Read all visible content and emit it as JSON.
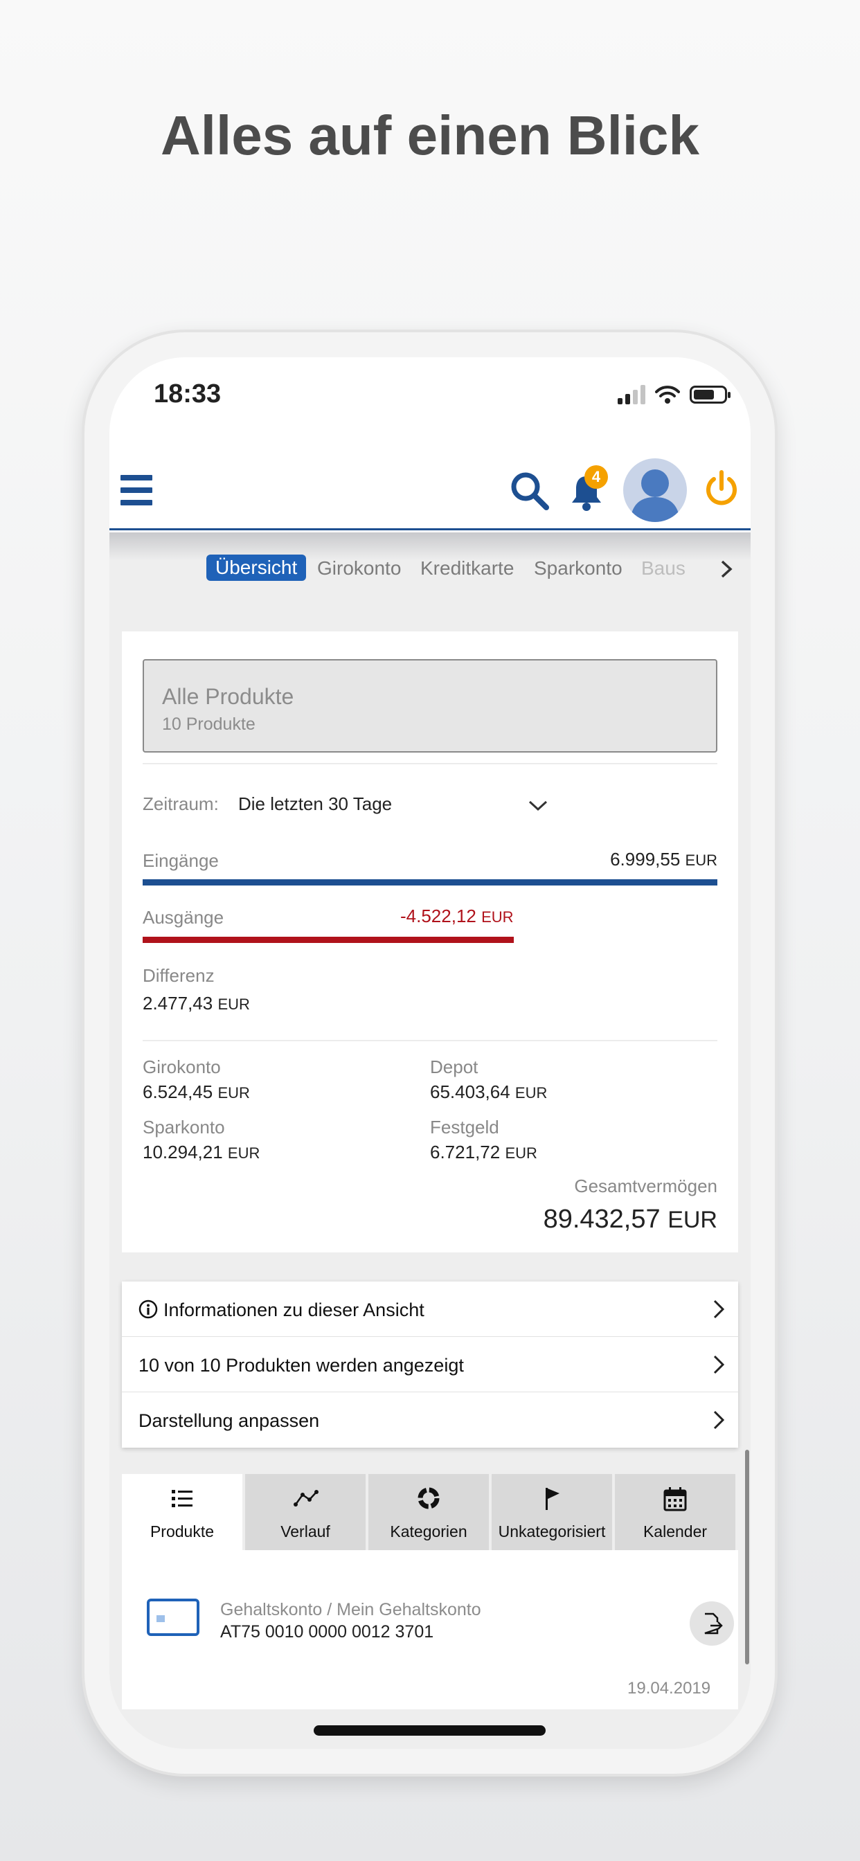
{
  "headline": "Alles auf einen Blick",
  "status": {
    "time": "18:33"
  },
  "header": {
    "notification_count": "4"
  },
  "tabs": [
    {
      "label": "Übersicht",
      "active": true
    },
    {
      "label": "Girokonto"
    },
    {
      "label": "Kreditkarte"
    },
    {
      "label": "Sparkonto"
    },
    {
      "label": "Baus"
    }
  ],
  "products": {
    "title": "Alle Produkte",
    "count": "10 Produkte"
  },
  "period": {
    "label": "Zeitraum:",
    "value": "Die letzten 30 Tage"
  },
  "income": {
    "label": "Eingänge",
    "amount": "6.999,55",
    "currency": "EUR",
    "bar_fraction": 1.0
  },
  "expenses": {
    "label": "Ausgänge",
    "amount": "-4.522,12",
    "currency": "EUR",
    "bar_fraction": 0.646
  },
  "difference": {
    "label": "Differenz",
    "amount": "2.477,43",
    "currency": "EUR"
  },
  "accounts": [
    {
      "label": "Girokonto",
      "amount": "6.524,45",
      "currency": "EUR"
    },
    {
      "label": "Depot",
      "amount": "65.403,64",
      "currency": "EUR"
    },
    {
      "label": "Sparkonto",
      "amount": "10.294,21",
      "currency": "EUR"
    },
    {
      "label": "Festgeld",
      "amount": "6.721,72",
      "currency": "EUR"
    }
  ],
  "total": {
    "label": "Gesamtvermögen",
    "amount": "89.432,57",
    "currency": "EUR"
  },
  "menu": [
    {
      "label": "Informationen zu dieser Ansicht"
    },
    {
      "label": "10 von 10 Produkten werden angezeigt"
    },
    {
      "label": "Darstellung anpassen"
    }
  ],
  "bottom_tabs": [
    {
      "label": "Produkte",
      "icon": "list-icon",
      "active": true
    },
    {
      "label": "Verlauf",
      "icon": "trend-icon"
    },
    {
      "label": "Kategorien",
      "icon": "pie-icon"
    },
    {
      "label": "Unkategorisiert",
      "icon": "flag-icon"
    },
    {
      "label": "Kalender",
      "icon": "calendar-icon"
    }
  ],
  "account_item": {
    "name": "Gehaltskonto / Mein Gehaltskonto",
    "iban": "AT75 0010 0000 0012 3701",
    "date": "19.04.2019"
  },
  "colors": {
    "brand_blue": "#1d4f91",
    "active_tab": "#1f62b8",
    "negative_red": "#b0121b",
    "badge_orange": "#f5a100"
  }
}
